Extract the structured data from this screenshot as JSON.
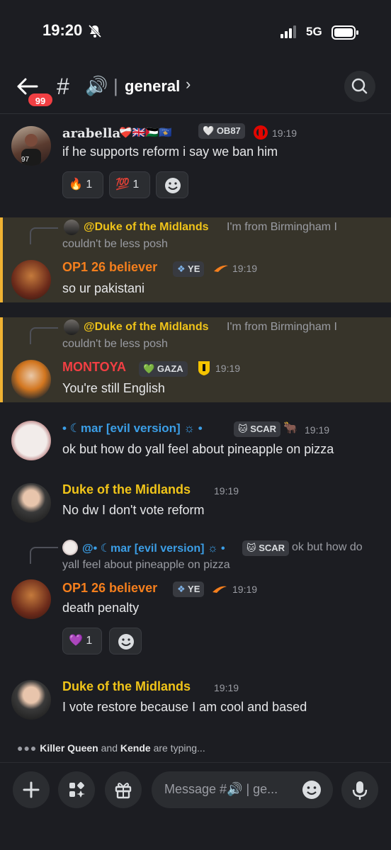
{
  "status": {
    "time": "19:20",
    "network": "5G"
  },
  "header": {
    "unread_badge": "99",
    "hash": "#",
    "channel_emoji": "🔊",
    "separator": "|",
    "channel": "general",
    "chevron": "›"
  },
  "messages": [
    {
      "username": "arabella",
      "username_deco": "❤️‍🩹🇬🇧🇵🇸🇽🇰",
      "tag": "OB87",
      "time": "19:19",
      "text": "if he supports reform i say we ban him",
      "reactions": [
        {
          "emoji": "🔥",
          "count": "1"
        },
        {
          "emoji": "💯",
          "count": "1"
        }
      ]
    },
    {
      "reply_to": "@Duke of the Midlands",
      "reply_text_1": "I'm from Birmingham I",
      "reply_text_2": "couldn't be less posh",
      "username": "OP1 26 believer",
      "tag": "YE",
      "time": "19:19",
      "text": "so ur pakistani"
    },
    {
      "reply_to": "@Duke of the Midlands",
      "reply_text_1": "I'm from Birmingham I",
      "reply_text_2": "couldn't be less posh",
      "username": "MONTOYA",
      "tag": "GAZA",
      "time": "19:19",
      "text": "You're still English"
    },
    {
      "username": "• ☾mar [evil version] ☼ •",
      "tag": "SCAR",
      "time": "19:19",
      "text": "ok but how do yall feel about pineapple on pizza"
    },
    {
      "username": "Duke of the Midlands",
      "time": "19:19",
      "text": "No dw I don't vote reform"
    },
    {
      "reply_to": "@• ☾mar [evil version] ☼ •",
      "reply_tag": "SCAR",
      "reply_text_1": "ok but how do",
      "reply_text_2": "yall feel about pineapple on pizza",
      "username": "OP1 26 believer",
      "tag": "YE",
      "time": "19:19",
      "text": "death penalty",
      "reactions": [
        {
          "emoji": "💜",
          "count": "1"
        }
      ]
    },
    {
      "username": "Duke of the Midlands",
      "time": "19:19",
      "text": "I vote restore because I am cool and based"
    }
  ],
  "typing": {
    "user1": "Killer Queen",
    "and": "and",
    "user2": "Kende",
    "suffix": "are typing..."
  },
  "composer": {
    "placeholder": "Message #🔊 | ge..."
  },
  "colors": {
    "orange": "#f57f1d",
    "red": "#f23f43",
    "gold": "#f0c419",
    "blue": "#3b9ee6",
    "highlight": "#37342a"
  }
}
